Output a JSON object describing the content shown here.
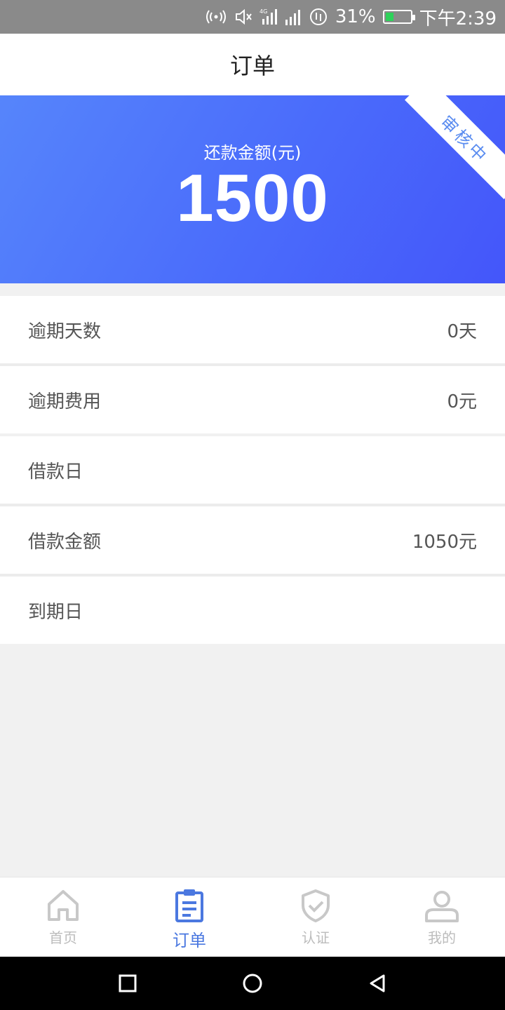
{
  "status_bar": {
    "battery_percent": "31%",
    "battery_level": 0.31,
    "time": "下午2:39",
    "network": "4G",
    "icons": [
      "hotspot-icon",
      "mute-icon",
      "signal-4g-icon",
      "signal-icon",
      "sync-icon"
    ]
  },
  "header": {
    "title": "订单"
  },
  "banner": {
    "label": "还款金额(元)",
    "amount": "1500",
    "badge": "审核中",
    "colors": {
      "start": "#5685fb",
      "end": "#4456fa"
    }
  },
  "details": {
    "overdue_days": {
      "label": "逾期天数",
      "value": "0天"
    },
    "overdue_fee": {
      "label": "逾期费用",
      "value": "0元"
    },
    "loan_date": {
      "label": "借款日",
      "value": ""
    },
    "loan_amount": {
      "label": "借款金额",
      "value": "1050元"
    },
    "due_date": {
      "label": "到期日",
      "value": ""
    }
  },
  "tabbar": {
    "active_color": "#4b78e0",
    "inactive_color": "#bcbcbc",
    "items": [
      {
        "label": "首页",
        "icon": "home-icon"
      },
      {
        "label": "订单",
        "icon": "order-icon",
        "active": true
      },
      {
        "label": "认证",
        "icon": "shield-check-icon"
      },
      {
        "label": "我的",
        "icon": "user-icon"
      }
    ]
  },
  "system_nav": {
    "icons": [
      "recents-icon",
      "home-circle-icon",
      "back-icon"
    ]
  }
}
